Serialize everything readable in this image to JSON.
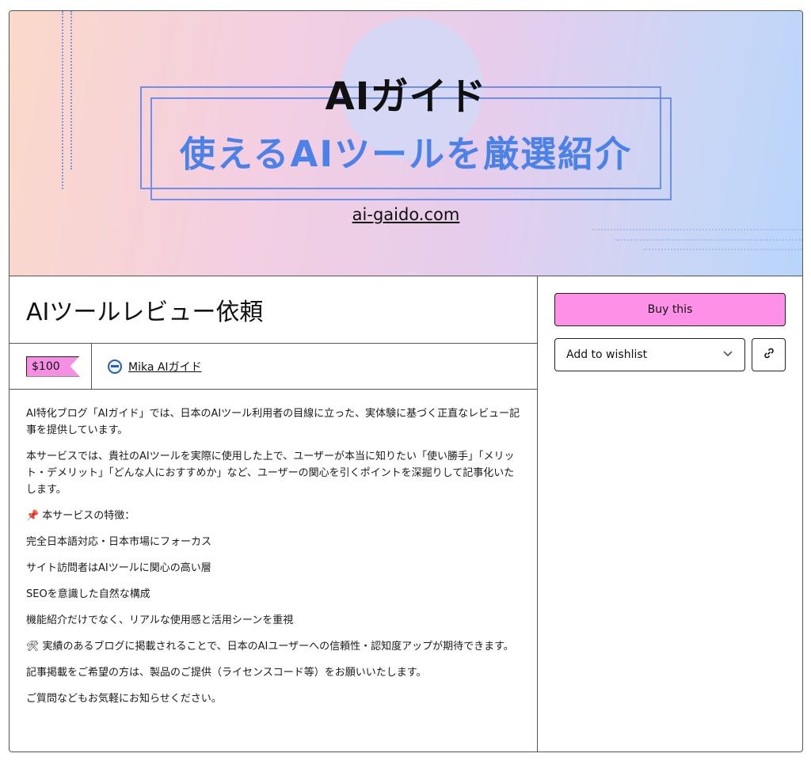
{
  "banner": {
    "title": "AIガイド",
    "subtitle": "使えるAIツールを厳選紹介",
    "url": "ai-gaido.com"
  },
  "product": {
    "title": "AIツールレビュー依頼",
    "price": "$100",
    "seller": "Mika AIガイド"
  },
  "actions": {
    "buy_label": "Buy this",
    "wishlist_label": "Add to wishlist"
  },
  "icons": {
    "pin": "📌",
    "tools": "🛠"
  },
  "description": [
    "AI特化ブログ「AIガイド」では、日本のAIツール利用者の目線に立った、実体験に基づく正直なレビュー記事を提供しています。",
    "本サービスでは、貴社のAIツールを実際に使用した上で、ユーザーが本当に知りたい「使い勝手」「メリット・デメリット」「どんな人におすすめか」など、ユーザーの関心を引くポイントを深掘りして記事化いたします。",
    "本サービスの特徴：",
    "完全日本語対応・日本市場にフォーカス",
    "サイト訪問者はAIツールに関心の高い層",
    "SEOを意識した自然な構成",
    "機能紹介だけでなく、リアルな使用感と活用シーンを重視",
    "実績のあるブログに掲載されることで、日本のAIユーザーへの信頼性・認知度アップが期待できます。",
    "記事掲載をご希望の方は、製品のご提供（ライセンスコード等）をお願いいたします。",
    "ご質問などもお気軽にお知らせください。"
  ],
  "colors": {
    "accent_pink": "#ff90e8",
    "banner_blue": "#4a82ea"
  }
}
